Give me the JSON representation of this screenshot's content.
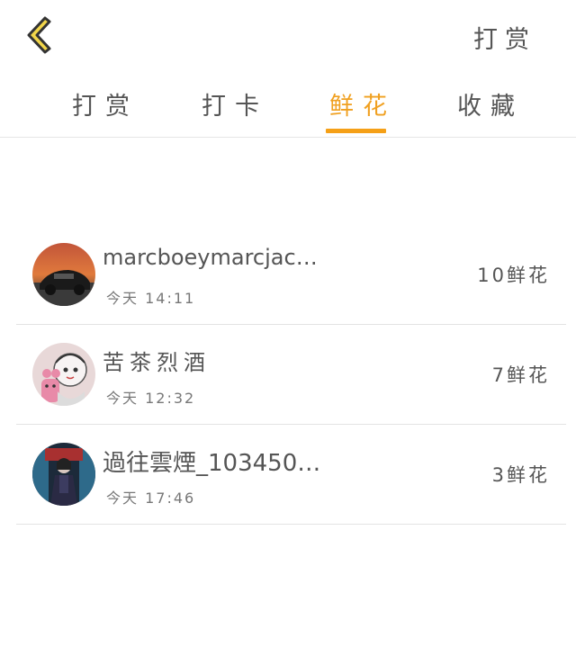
{
  "topbar": {
    "back_icon": "chevron-left-icon",
    "action_label": "打赏",
    "accent_color": "#f5a017"
  },
  "tabs": [
    {
      "label": "打赏",
      "active": false
    },
    {
      "label": "打卡",
      "active": false
    },
    {
      "label": "鲜花",
      "active": true
    },
    {
      "label": "收藏",
      "active": false
    }
  ],
  "records": [
    {
      "name": "marcboeymarcjaco…",
      "time": "今天 14:11",
      "amount": "10鲜花",
      "avatar": "car-avatar"
    },
    {
      "name": "苦茶烈酒",
      "time": "今天 12:32",
      "amount": "7鲜花",
      "avatar": "cartoon-girl-avatar"
    },
    {
      "name": "過往雲煙_103450…",
      "time": "今天 17:46",
      "amount": "3鲜花",
      "avatar": "dark-figure-avatar"
    }
  ]
}
